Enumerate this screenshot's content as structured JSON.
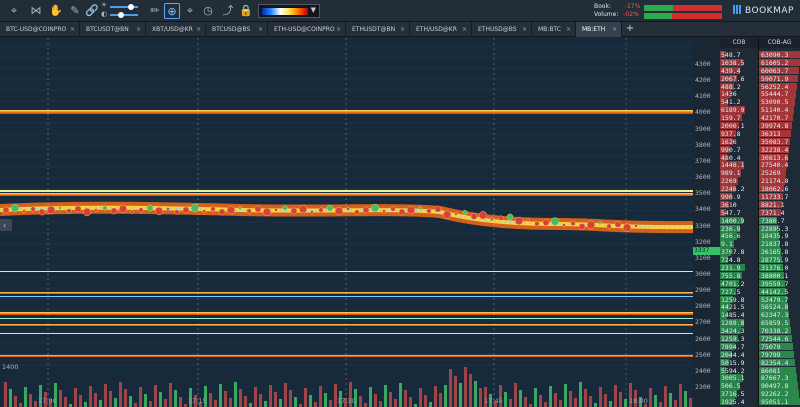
{
  "toolbar": {
    "book_label": "Book:",
    "book_value": "-17%",
    "volume_label": "Volume:",
    "volume_value": "-02%",
    "book_meter_green": 0.37,
    "volume_meter_green": 0.36,
    "brand": "BOOKMAP",
    "icons": [
      "crosshair-target-icon",
      "share-icon",
      "hand-tool-icon",
      "link-icon",
      "brightness-icon",
      "contrast-icon",
      "pen-icon",
      "zoom-fit-icon",
      "cursor-icon",
      "timer-icon",
      "trend-icon",
      "lock-icon"
    ],
    "gradient_colors": [
      "#0b2aa8",
      "#1f8cff",
      "#ffffff",
      "#ffe23a",
      "#ff6a00",
      "#b40000"
    ]
  },
  "tabs": [
    {
      "label": "BTC-USD@COINPRO"
    },
    {
      "label": "BTCUSDT@BN"
    },
    {
      "label": "XBT/USD@KR"
    },
    {
      "label": "BTCUSD@BS"
    },
    {
      "label": "ETH-USD@COINPRO"
    },
    {
      "label": "ETHUSDT@BN"
    },
    {
      "label": "ETH/USD@KR"
    },
    {
      "label": "ETHUSD@BS"
    },
    {
      "label": "MB:BTC"
    },
    {
      "label": "MB:ETH",
      "active": true
    }
  ],
  "tab_close": "×",
  "tab_add": "+",
  "price_axis": [
    "4300",
    "4200",
    "4100",
    "4000",
    "3900",
    "3800",
    "3700",
    "3600",
    "3500",
    "3400",
    "3300",
    "3200",
    "3100",
    "3000",
    "2900",
    "2800",
    "2700",
    "2600",
    "2500",
    "2400",
    "2300"
  ],
  "current_price": "3337",
  "time_axis": [
    "17:00",
    "17:15",
    "17:30",
    "17:45",
    "18:00"
  ],
  "volume_scale": "1400",
  "cob": {
    "header": "COB",
    "values": [
      "548.7",
      "1038.5",
      "439.4",
      "2067.6",
      "488.2",
      "1436",
      "541.2",
      "6189.9",
      "159.7",
      "2000.1",
      "937.8",
      "1626",
      "990.7",
      "480.4",
      "1448.1",
      "989.1",
      "2269",
      "2248.2",
      "990.9",
      "3610",
      "547.7",
      "1400.9",
      "236.9",
      "456.6",
      "9.1",
      "3707.8",
      "724.8",
      "231.9",
      "755.8",
      "4701.2",
      "727.5",
      "1259.8",
      "4421.5",
      "1485.4",
      "1289.8",
      "3424.3",
      "1259.3",
      "7894.7",
      "2044.4",
      "5015.9",
      "5594.2",
      "3005.1",
      "506.5",
      "3716.5",
      "1925.4"
    ]
  },
  "cob_ag": {
    "header": "COB-AG",
    "values": [
      "63090.3",
      "61605.2",
      "60063.7",
      "59071.9",
      "56252.4",
      "55444.7",
      "53090.5",
      "51140.4",
      "42170.7",
      "39974.8",
      "36313",
      "35083.7",
      "32238.4",
      "30813.6",
      "27540.4",
      "25269",
      "21174.8",
      "18062.6",
      "11733.7",
      "8821.1",
      "7371.4",
      "7380.7",
      "22895.3",
      "18435.9",
      "21837.8",
      "26165.8",
      "28775.9",
      "31376.0",
      "38800.1",
      "39559.7",
      "44142.5",
      "52479.7",
      "56524.8",
      "62347.3",
      "65859.5",
      "70338.2",
      "72544.6",
      "75079",
      "79799",
      "82354.4",
      "86081",
      "87667.3",
      "90497.8",
      "92262.2",
      "95051.1"
    ]
  }
}
